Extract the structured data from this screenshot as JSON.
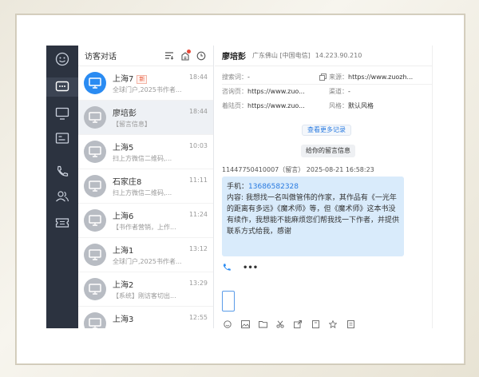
{
  "sidebar": {
    "icons": [
      "smiley-logo-icon",
      "chat-icon",
      "monitor-icon",
      "card-icon",
      "phone-icon",
      "users-icon",
      "ticket-icon"
    ]
  },
  "list": {
    "title": "访客对话",
    "conversations": [
      {
        "name": "上海7",
        "badge": "新",
        "time": "18:44",
        "snippet": "全球门户,2025书作者...",
        "avatar": "blue"
      },
      {
        "name": "廖培彭",
        "badge": "",
        "time": "18:44",
        "snippet": "【留言信息】",
        "avatar": "gray",
        "selected": true
      },
      {
        "name": "上海5",
        "badge": "",
        "time": "10:03",
        "snippet": "扫上方微信二维码,...",
        "avatar": "gray"
      },
      {
        "name": "石家庄8",
        "badge": "",
        "time": "11:11",
        "snippet": "扫上方微信二维码,...",
        "avatar": "gray"
      },
      {
        "name": "上海6",
        "badge": "",
        "time": "11:24",
        "snippet": "【书作者营销，上作...",
        "avatar": "gray"
      },
      {
        "name": "上海1",
        "badge": "",
        "time": "13:12",
        "snippet": "全球门户,2025书作者...",
        "avatar": "gray"
      },
      {
        "name": "上海2",
        "badge": "",
        "time": "13:29",
        "snippet": "【系统】刚访客切出...",
        "avatar": "gray"
      },
      {
        "name": "上海3",
        "badge": "",
        "time": "12:55",
        "snippet": "",
        "avatar": "gray"
      }
    ]
  },
  "detail": {
    "name": "廖培彭",
    "location": "广东佛山 [中国电信]",
    "ip": "14.223.90.210",
    "info": {
      "search_k": "搜索词：",
      "search_v": "-",
      "source_k": "来源：",
      "source_v": "https://www.zuozh...",
      "consult_k": "咨询页：",
      "consult_v": "https://www.zuo...",
      "channel_k": "渠道：",
      "channel_v": "-",
      "landing_k": "着陆页：",
      "landing_v": "https://www.zuo...",
      "style_k": "风格：",
      "style_v": "默认风格"
    },
    "more_records": "查看更多记录",
    "leave_msg": "给你的留言信息",
    "msg_meta": "11447750410007（留言）  2025-08-21 16:58:23",
    "phone_label": "手机：",
    "phone_value": "13686582328",
    "content": "内容: 我想找一名叫傲管伟的作家，其作品有《一光年的距离有多远》《魔术师》等，但《魔术师》这本书没有续作，我想能不能麻烦您们帮我找一下作者，并提供联系方式给我，感谢",
    "more_actions": "•••"
  },
  "colors": {
    "rail": "#2c3340",
    "accent": "#2a8bf2",
    "bubble": "#d9ebfb"
  }
}
